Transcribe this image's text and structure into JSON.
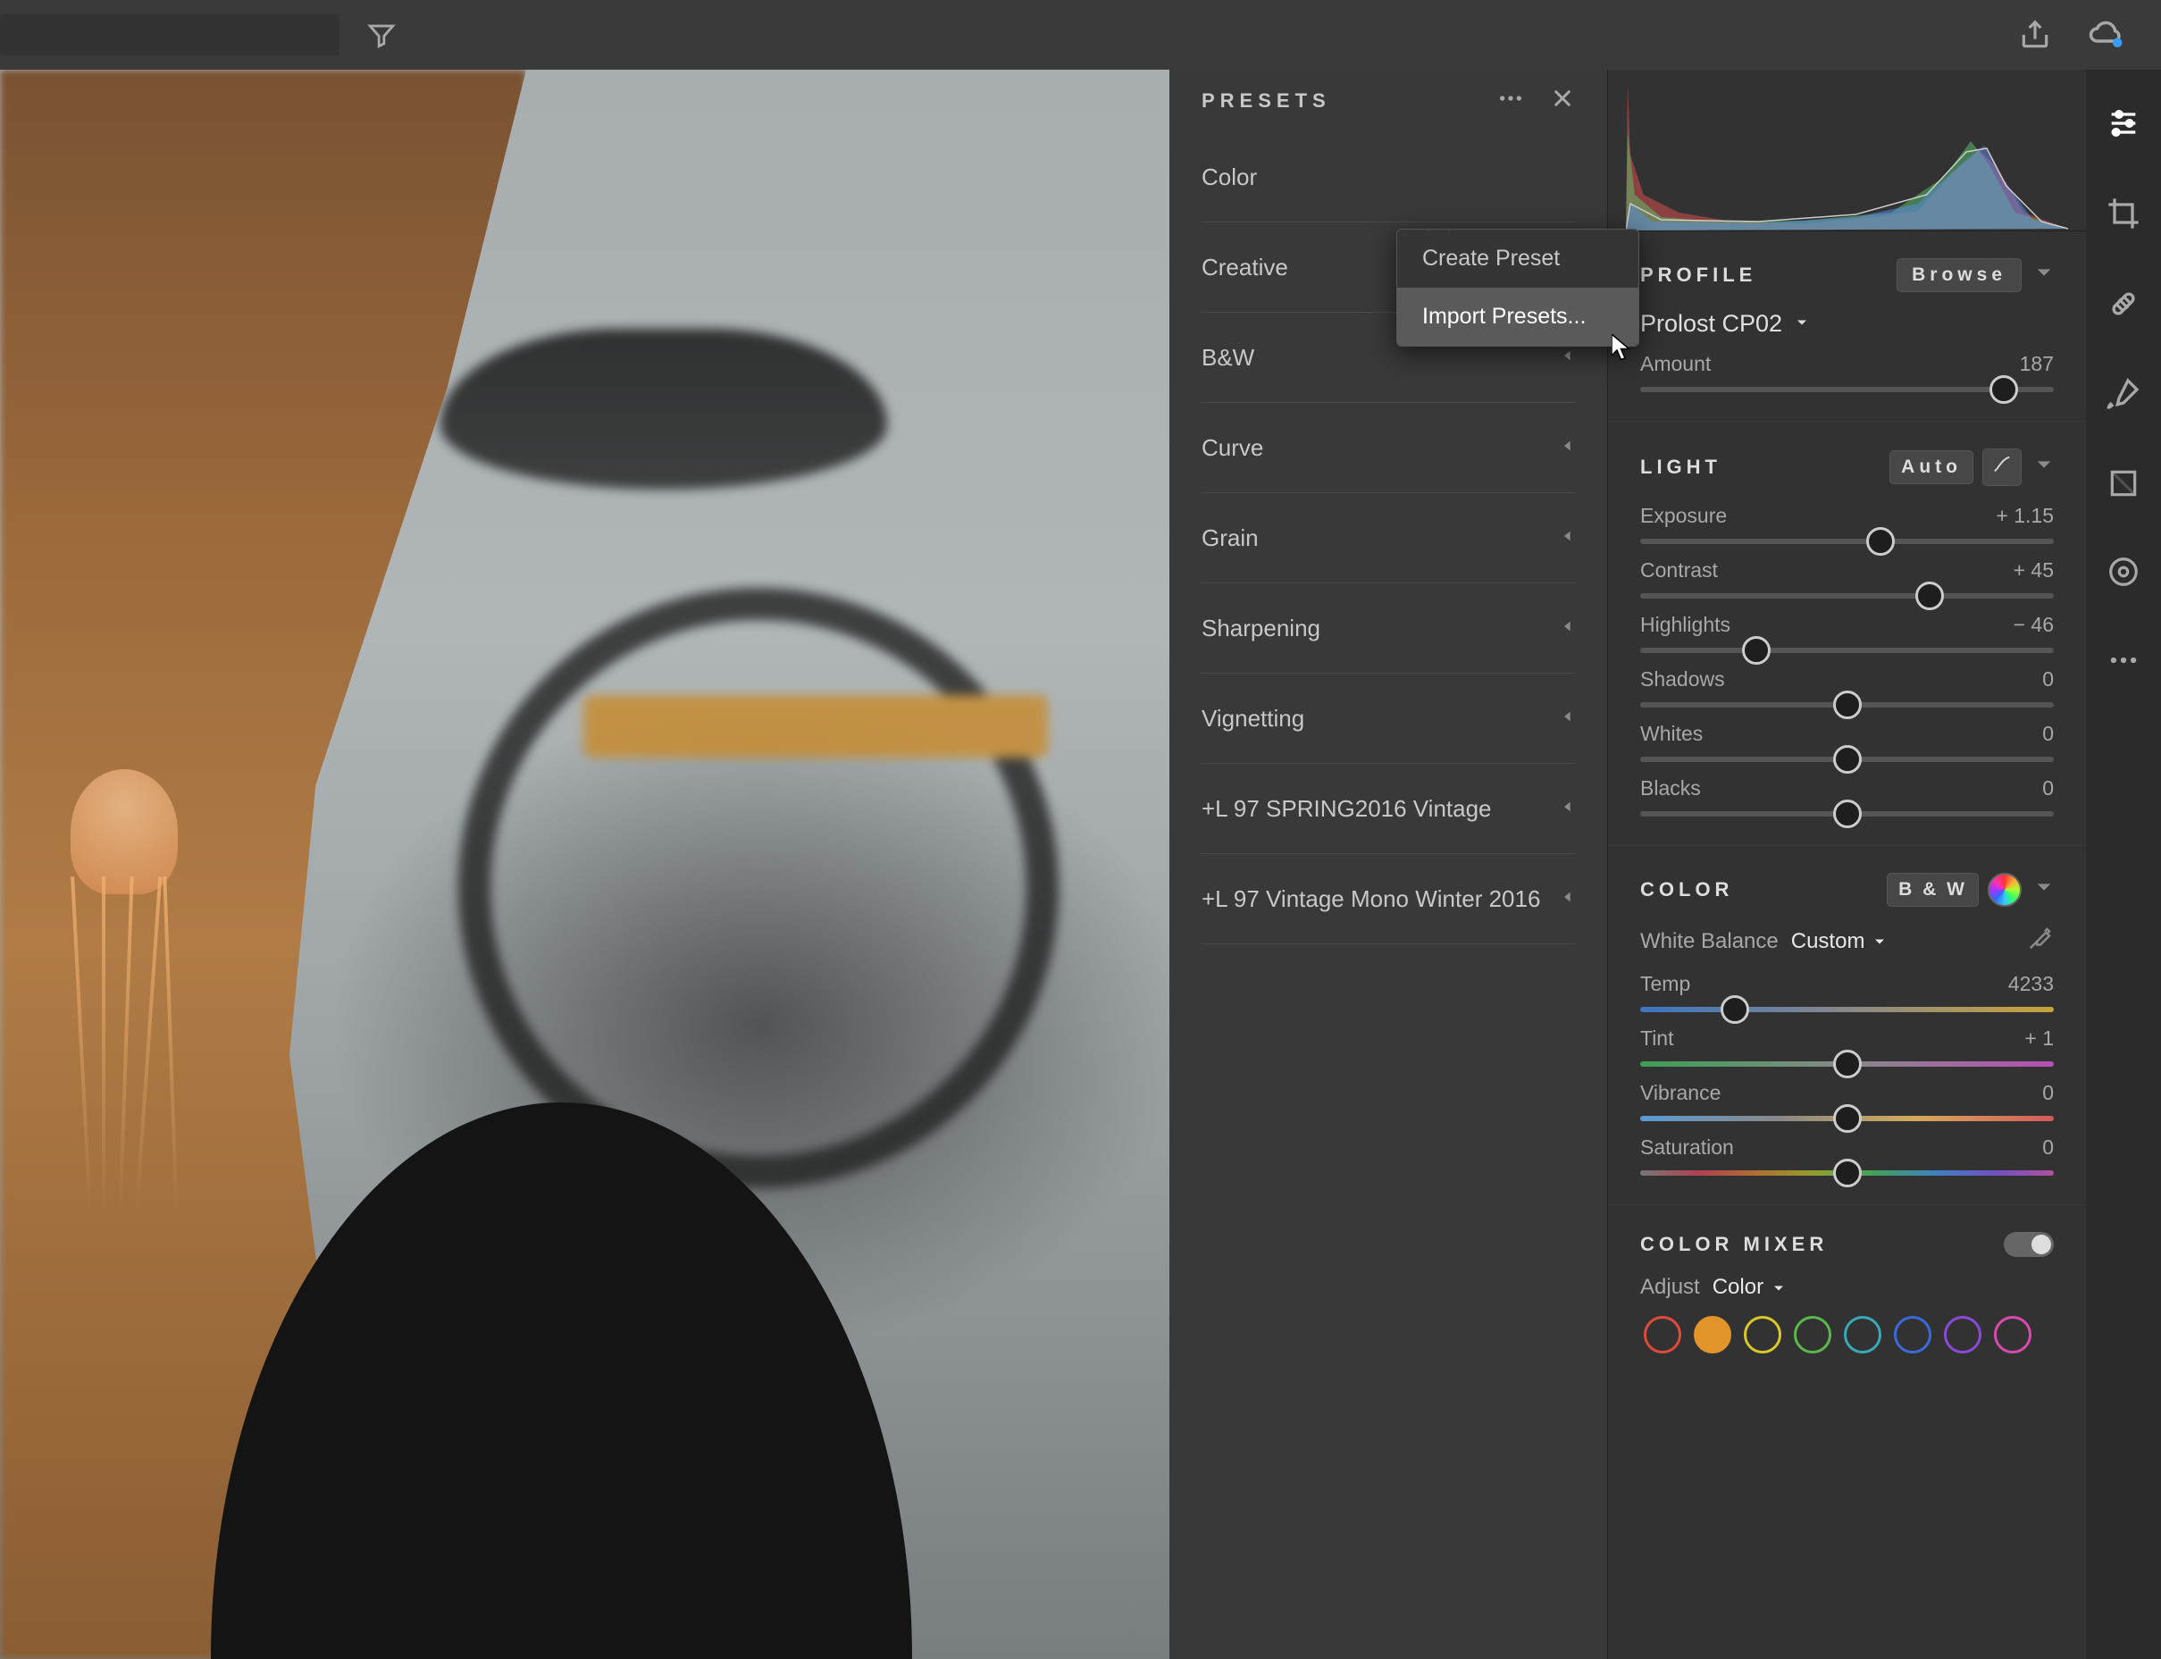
{
  "topbar": {
    "search_placeholder": ""
  },
  "presets": {
    "title": "PRESETS",
    "groups": [
      {
        "label": "Color",
        "collapsible": false
      },
      {
        "label": "Creative",
        "collapsible": false
      },
      {
        "label": "B&W",
        "collapsible": true
      },
      {
        "label": "Curve",
        "collapsible": true
      },
      {
        "label": "Grain",
        "collapsible": true
      },
      {
        "label": "Sharpening",
        "collapsible": true
      },
      {
        "label": "Vignetting",
        "collapsible": true
      },
      {
        "label": "+L 97 SPRING2016 Vintage",
        "collapsible": true
      },
      {
        "label": "+L 97 Vintage Mono Winter 2016",
        "collapsible": true
      }
    ],
    "menu": {
      "create": "Create Preset",
      "import": "Import Presets..."
    }
  },
  "profile": {
    "heading": "PROFILE",
    "browse": "Browse",
    "name": "Prolost CP02",
    "amount_label": "Amount",
    "amount_value": "187",
    "amount_pct": 88
  },
  "light": {
    "heading": "LIGHT",
    "auto": "Auto",
    "sliders": {
      "exposure": {
        "label": "Exposure",
        "value": "+ 1.15",
        "pct": 58
      },
      "contrast": {
        "label": "Contrast",
        "value": "+ 45",
        "pct": 70
      },
      "highlights": {
        "label": "Highlights",
        "value": "− 46",
        "pct": 28
      },
      "shadows": {
        "label": "Shadows",
        "value": "0",
        "pct": 50
      },
      "whites": {
        "label": "Whites",
        "value": "0",
        "pct": 50
      },
      "blacks": {
        "label": "Blacks",
        "value": "0",
        "pct": 50
      }
    }
  },
  "color": {
    "heading": "COLOR",
    "bw": "B & W",
    "wb_label": "White Balance",
    "wb_value": "Custom",
    "sliders": {
      "temp": {
        "label": "Temp",
        "value": "4233",
        "pct": 23
      },
      "tint": {
        "label": "Tint",
        "value": "+ 1",
        "pct": 50
      },
      "vibrance": {
        "label": "Vibrance",
        "value": "0",
        "pct": 50
      },
      "saturation": {
        "label": "Saturation",
        "value": "0",
        "pct": 50
      }
    }
  },
  "mixer": {
    "heading": "COLOR MIXER",
    "adjust_label": "Adjust",
    "adjust_value": "Color",
    "hues": [
      "#e04a3a",
      "#e0942a",
      "#d8c82a",
      "#5ab84a",
      "#3aa8b8",
      "#3a6ad8",
      "#8a4ad8",
      "#d84ab0"
    ],
    "selected_hue": 1
  }
}
